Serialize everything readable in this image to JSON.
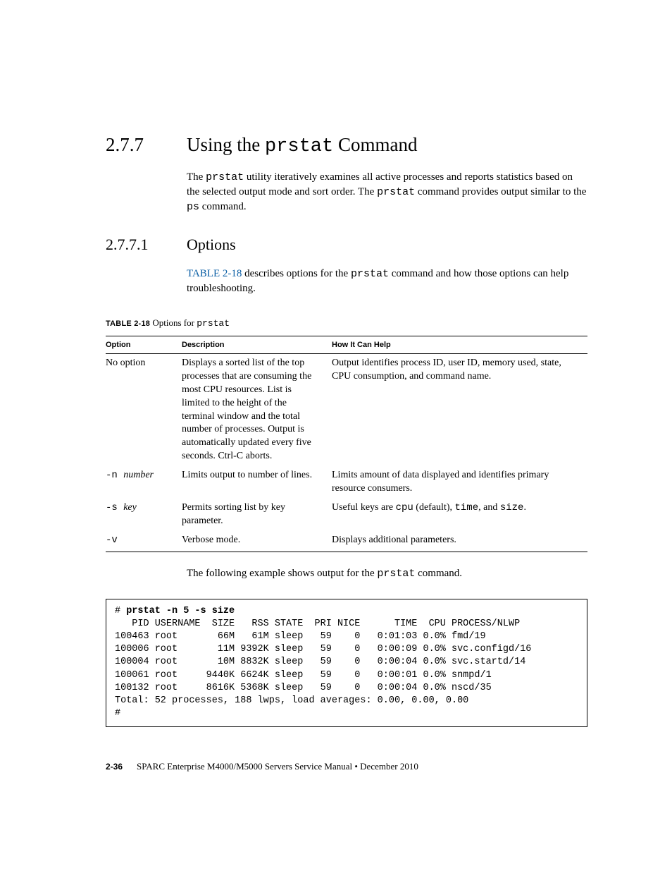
{
  "section": {
    "number": "2.7.7",
    "title_pre": "Using the ",
    "title_code": "prstat",
    "title_post": " Command"
  },
  "intro": {
    "t1": "The ",
    "c1": "prstat",
    "t2": " utility iteratively examines all active processes and reports statistics based on the selected output mode and sort order. The ",
    "c2": "prstat",
    "t3": " command provides output similar to the ",
    "c3": "ps",
    "t4": " command."
  },
  "subsection": {
    "number": "2.7.7.1",
    "title": "Options"
  },
  "options_intro": {
    "link": "TABLE 2-18",
    "t1": " describes options for the ",
    "c1": "prstat",
    "t2": " command and how those options can help troubleshooting."
  },
  "table_caption": {
    "label": "TABLE 2-18",
    "text_pre": "   Options for ",
    "text_code": "prstat"
  },
  "table": {
    "headers": {
      "opt": "Option",
      "desc": "Description",
      "help": "How It Can Help"
    },
    "rows": [
      {
        "opt_text": "No option",
        "desc": "Displays a sorted list of the top processes that are consuming the most CPU resources. List is limited to the height of the terminal window and the total number of processes. Output is automatically updated every five seconds. Ctrl-C aborts.",
        "help": "Output identifies process ID, user ID, memory used, state, CPU consumption, and command name."
      },
      {
        "opt_code": "-n ",
        "opt_italic": "number",
        "desc": "Limits output to number of lines.",
        "help": "Limits amount of data displayed and identifies primary resource consumers."
      },
      {
        "opt_code": "-s ",
        "opt_italic": "key",
        "desc": "Permits sorting list by key parameter.",
        "help_pre": "Useful keys are ",
        "help_c1": "cpu",
        "help_mid1": " (default), ",
        "help_c2": "time",
        "help_mid2": ", and ",
        "help_c3": "size",
        "help_post": "."
      },
      {
        "opt_code": "-v",
        "desc": "Verbose mode.",
        "help": "Displays additional parameters."
      }
    ]
  },
  "example_intro": {
    "t1": "The following example shows output for the ",
    "c1": "prstat",
    "t2": " command."
  },
  "code": {
    "prompt": "# ",
    "cmd": "prstat -n 5 -s size",
    "lines": [
      "   PID USERNAME  SIZE   RSS STATE  PRI NICE      TIME  CPU PROCESS/NLWP",
      "100463 root       66M   61M sleep   59    0   0:01:03 0.0% fmd/19",
      "100006 root       11M 9392K sleep   59    0   0:00:09 0.0% svc.configd/16",
      "100004 root       10M 8832K sleep   59    0   0:00:04 0.0% svc.startd/14",
      "100061 root     9440K 6624K sleep   59    0   0:00:01 0.0% snmpd/1",
      "100132 root     8616K 5368K sleep   59    0   0:00:04 0.0% nscd/35",
      "Total: 52 processes, 188 lwps, load averages: 0.00, 0.00, 0.00",
      "#"
    ]
  },
  "footer": {
    "page": "2-36",
    "text": "SPARC Enterprise M4000/M5000 Servers Service Manual  •  December 2010"
  }
}
